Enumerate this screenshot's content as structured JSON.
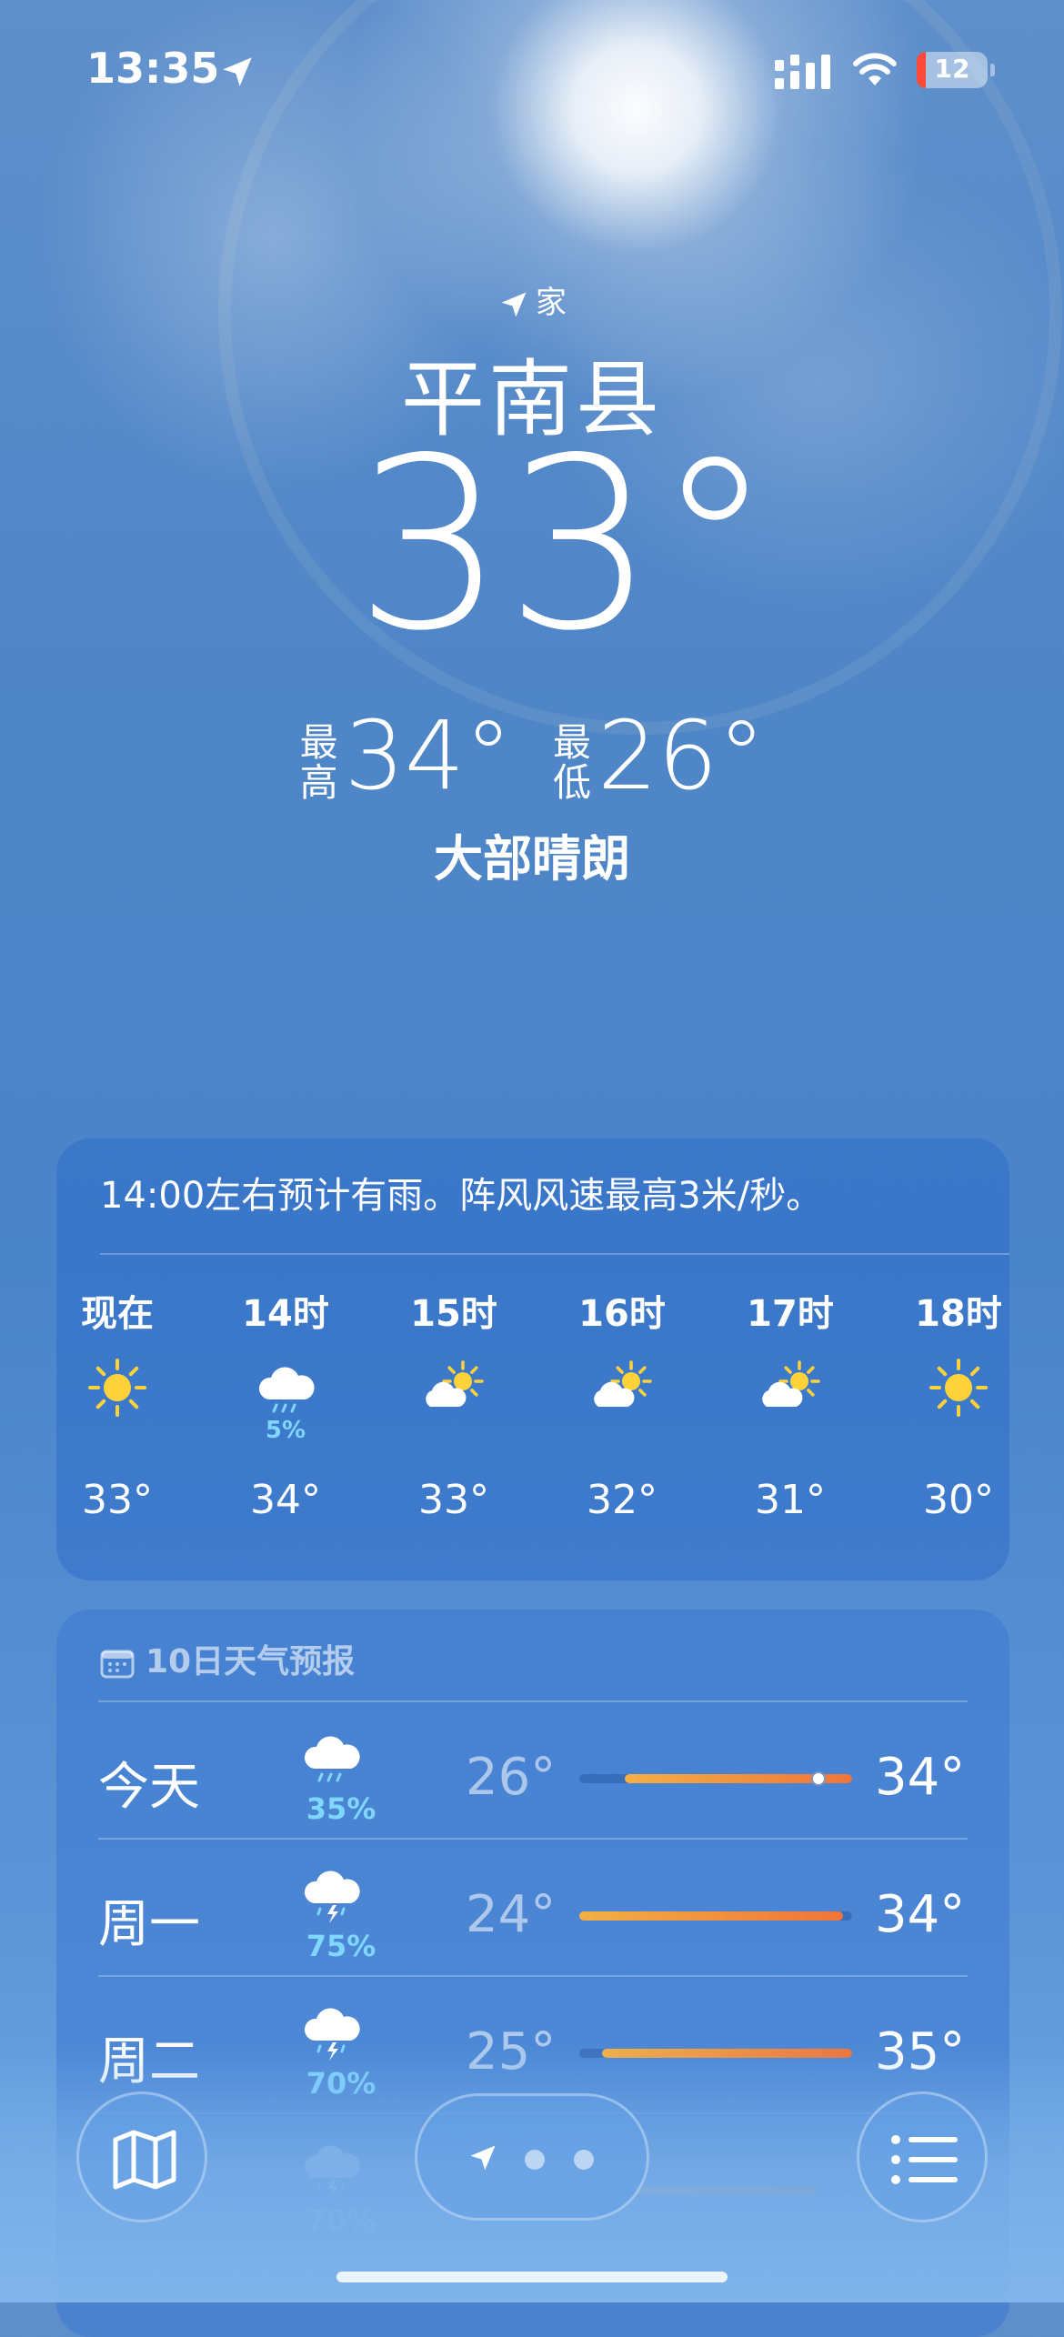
{
  "status_bar": {
    "time": "13:35",
    "battery": "12"
  },
  "header": {
    "location_tag": "家",
    "city": "平南县",
    "temperature": "33°",
    "high_label": "最高",
    "high": "34°",
    "low_label": "最低",
    "low": "26°",
    "condition": "大部晴朗"
  },
  "hourly": {
    "summary": "14:00左右预计有雨。阵风风速最高3米/秒。",
    "items": [
      {
        "label": "现在",
        "icon": "sun-icon",
        "precip": "",
        "temp": "33°"
      },
      {
        "label": "14时",
        "icon": "rain-cloud-icon",
        "precip": "5%",
        "temp": "34°"
      },
      {
        "label": "15时",
        "icon": "partly-sunny-icon",
        "precip": "",
        "temp": "33°"
      },
      {
        "label": "16时",
        "icon": "partly-sunny-icon",
        "precip": "",
        "temp": "32°"
      },
      {
        "label": "17时",
        "icon": "partly-sunny-icon",
        "precip": "",
        "temp": "31°"
      },
      {
        "label": "18时",
        "icon": "sun-icon",
        "precip": "",
        "temp": "30°"
      }
    ]
  },
  "daily": {
    "title": "10日天气预报",
    "items": [
      {
        "day": "今天",
        "icon": "rain-cloud-icon",
        "precip": "35%",
        "low": "26°",
        "high": "34°"
      },
      {
        "day": "周一",
        "icon": "thunderstorm-icon",
        "precip": "75%",
        "low": "24°",
        "high": "34°"
      },
      {
        "day": "周二",
        "icon": "thunderstorm-icon",
        "precip": "70%",
        "low": "25°",
        "high": "35°"
      },
      {
        "day": "",
        "icon": "thunderstorm-icon",
        "precip": "70%",
        "low": "",
        "high": ""
      }
    ]
  },
  "colors": {
    "accent_precip": "#7fd6ff",
    "bar_start": "#f3b044",
    "bar_end": "#f0743a"
  }
}
